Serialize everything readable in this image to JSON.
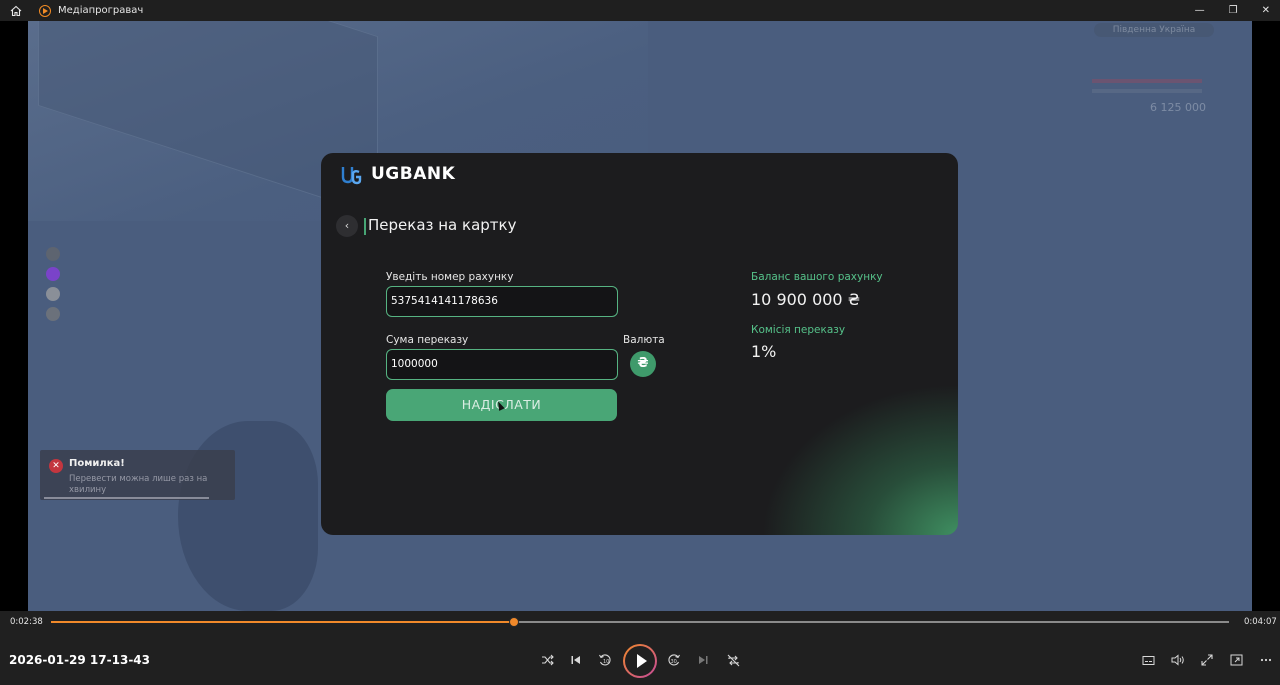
{
  "window": {
    "title": "Медіапрогравач",
    "minimize_glyph": "—",
    "restore_glyph": "❐",
    "close_glyph": "✕"
  },
  "toast": {
    "title": "Помилка!",
    "message": "Перевести можна лише раз на хвилину"
  },
  "game_hud": {
    "location": "Південна Україна",
    "money": "6 125 000"
  },
  "bank": {
    "brand": "UGBANK",
    "page_title": "Переказ на картку",
    "account_label": "Уведіть номер рахунку",
    "account_value": "5375414141178636",
    "amount_label": "Сума переказу",
    "amount_value": "1000000",
    "currency_label": "Валюта",
    "currency_symbol": "₴",
    "send_label": "НАДІСЛАТИ",
    "balance_label": "Баланс вашого рахунку",
    "balance_value": "10 900 000 ₴",
    "fee_label": "Комісія переказу",
    "fee_value": "1%",
    "accent_color": "#47a575"
  },
  "player": {
    "elapsed": "0:02:38",
    "total": "0:04:07",
    "progress": 0.393,
    "filename": "2026-01-29 17-13-43",
    "accent_color": "#f0892a"
  }
}
